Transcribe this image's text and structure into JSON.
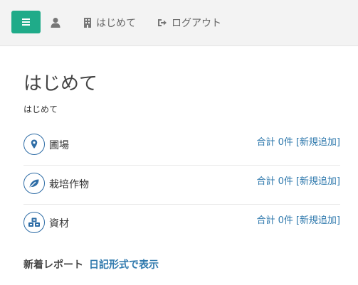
{
  "header": {
    "about_label": "はじめて",
    "logout_label": "ログアウト"
  },
  "page": {
    "title": "はじめて",
    "subtitle": "はじめて"
  },
  "items": [
    {
      "label": "圃場",
      "count": "合計 0件",
      "add": "[新規追加]",
      "icon": "map-pin-icon"
    },
    {
      "label": "栽培作物",
      "count": "合計 0件",
      "add": "[新規追加]",
      "icon": "leaf-icon"
    },
    {
      "label": "資材",
      "count": "合計 0件",
      "add": "[新規追加]",
      "icon": "cubes-icon"
    }
  ],
  "reports": {
    "title": "新着レポート",
    "diary_link": "日記形式で表示"
  },
  "colors": {
    "accent": "#1fab89",
    "link": "#2f79ad",
    "icon_border": "#2f6da6"
  }
}
